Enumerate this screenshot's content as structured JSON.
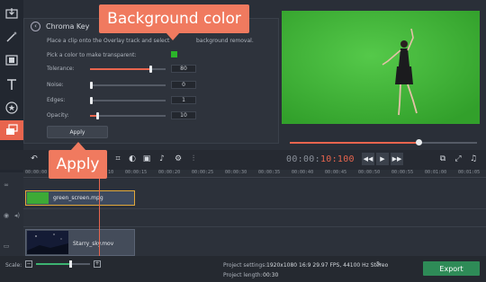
{
  "sidebar": {
    "tools": [
      {
        "icon": "import-icon"
      },
      {
        "icon": "magic-wand-icon"
      },
      {
        "icon": "filmstrip-icon"
      },
      {
        "icon": "titles-icon"
      },
      {
        "icon": "star-icon"
      },
      {
        "icon": "overlay-icon"
      },
      {
        "icon": "list-icon"
      }
    ]
  },
  "chroma": {
    "title": "Chroma Key",
    "hint": "Place a clip onto the Overlay track and select",
    "hint_tail": "background removal.",
    "pick_label": "Pick a color to make transparent:",
    "swatch_color": "#2bb52a",
    "tolerance": {
      "label": "Tolerance:",
      "value": "80",
      "fill": 0.8
    },
    "noise": {
      "label": "Noise:",
      "value": "0",
      "fill": 0.0
    },
    "edges": {
      "label": "Edges:",
      "value": "1",
      "fill": 0.01
    },
    "opacity": {
      "label": "Opacity:",
      "value": "10",
      "fill": 0.1
    },
    "apply_label": "Apply"
  },
  "callouts": {
    "background_color": "Background color",
    "apply": "Apply"
  },
  "player": {
    "progress": 0.69,
    "timecode_prefix": "00:00:",
    "timecode_highlight": "10:100"
  },
  "ruler": {
    "labels": [
      "00:00:00",
      "00:00:05",
      "00:00:10",
      "00:00:15",
      "00:00:20",
      "00:00:25",
      "00:00:30",
      "00:00:35",
      "00:00:40",
      "00:00:45",
      "00:00:50",
      "00:00:55",
      "00:01:00",
      "00:01:05"
    ]
  },
  "timeline": {
    "overlay_clip": "green_screen.mpg",
    "main_clip": "Starry_sky.mov"
  },
  "bottom": {
    "scale_label": "Scale:",
    "settings_label": "Project settings:",
    "settings_value": "1920x1080 16:9 29.97 FPS, 44100 Hz Stereo",
    "length_label": "Project length:",
    "length_value": "00:30",
    "export_label": "Export"
  },
  "colors": {
    "accent": "#e8654e",
    "export": "#2e8b57",
    "chroma_green": "#46b83c"
  }
}
